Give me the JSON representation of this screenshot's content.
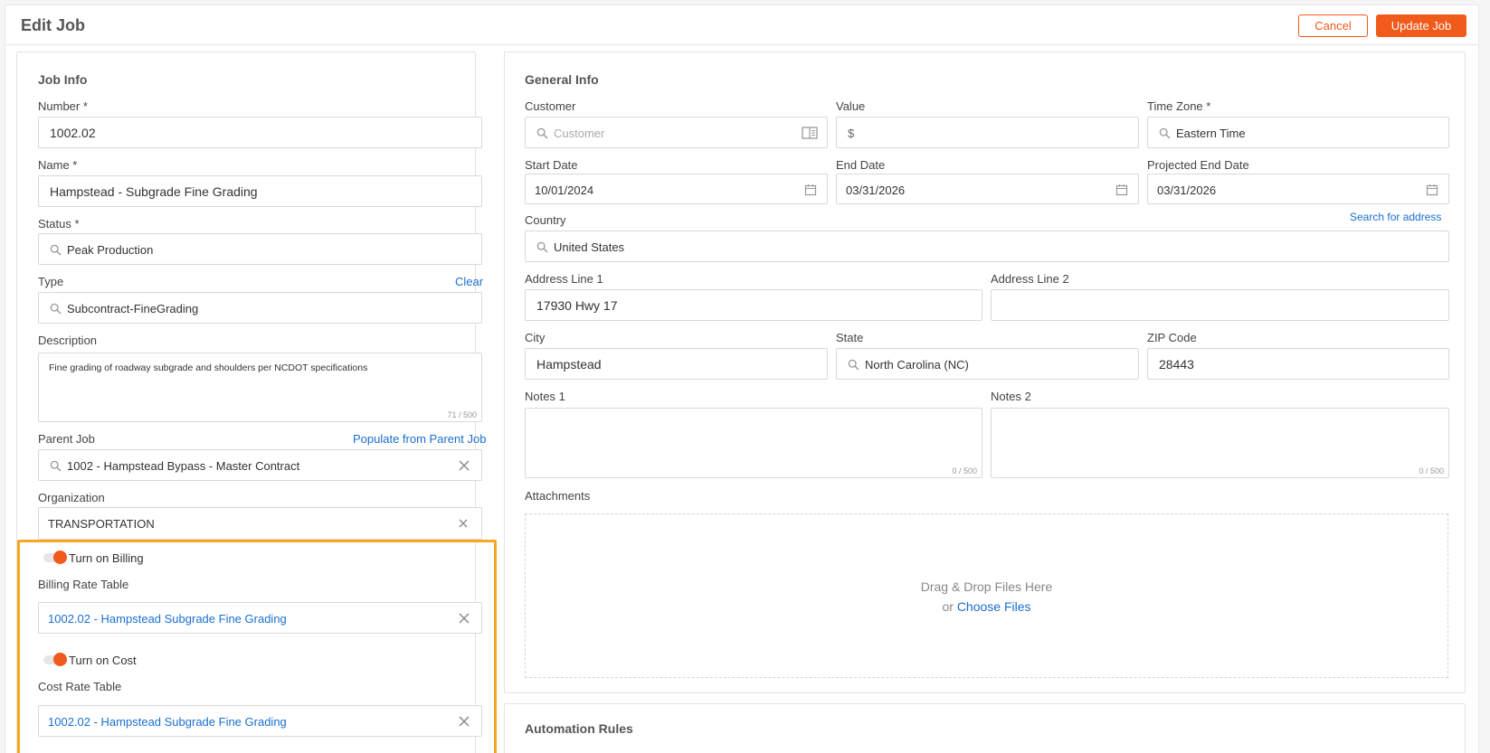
{
  "header": {
    "title": "Edit Job",
    "cancel_label": "Cancel",
    "update_label": "Update Job"
  },
  "job_info": {
    "section_title": "Job Info",
    "number_label": "Number *",
    "number_value": "1002.02",
    "name_label": "Name *",
    "name_value": "Hampstead - Subgrade Fine Grading",
    "status_label": "Status *",
    "status_value": "Peak Production",
    "type_label": "Type",
    "type_clear": "Clear",
    "type_value": "Subcontract-FineGrading",
    "description_label": "Description",
    "description_value": "Fine grading of roadway subgrade and shoulders per NCDOT specifications",
    "description_counter": "71 / 500",
    "parent_label": "Parent Job",
    "parent_populate": "Populate from Parent Job",
    "parent_value": "1002 - Hampstead Bypass - Master Contract",
    "org_label": "Organization",
    "org_value": "TRANSPORTATION",
    "billing_toggle_label": "Turn on Billing",
    "billing_table_label": "Billing Rate Table",
    "billing_table_value": "1002.02 - Hampstead Subgrade Fine Grading",
    "cost_toggle_label": "Turn on Cost",
    "cost_table_label": "Cost Rate Table",
    "cost_table_value": "1002.02 - Hampstead Subgrade Fine Grading"
  },
  "general_info": {
    "section_title": "General Info",
    "customer_label": "Customer",
    "customer_placeholder": "Customer",
    "value_label": "Value",
    "value_prefix": "$",
    "timezone_label": "Time Zone *",
    "timezone_value": "Eastern Time",
    "start_label": "Start Date",
    "start_value": "10/01/2024",
    "end_label": "End Date",
    "end_value": "03/31/2026",
    "proj_end_label": "Projected End Date",
    "proj_end_value": "03/31/2026",
    "country_label": "Country",
    "search_address": "Search for address",
    "country_value": "United States",
    "addr1_label": "Address Line 1",
    "addr1_value": "17930 Hwy 17",
    "addr2_label": "Address Line 2",
    "addr2_value": "",
    "city_label": "City",
    "city_value": "Hampstead",
    "state_label": "State",
    "state_value": "North Carolina (NC)",
    "zip_label": "ZIP Code",
    "zip_value": "28443",
    "notes1_label": "Notes 1",
    "notes1_counter": "0 / 500",
    "notes2_label": "Notes 2",
    "notes2_counter": "0 / 500",
    "attachments_label": "Attachments",
    "dropzone_text": "Drag & Drop Files Here",
    "dropzone_or": "or",
    "dropzone_link": "Choose Files"
  },
  "automation": {
    "section_title": "Automation Rules"
  },
  "colors": {
    "accent": "#f05a1a",
    "link": "#1a6fd0",
    "highlight": "#f5a623"
  }
}
